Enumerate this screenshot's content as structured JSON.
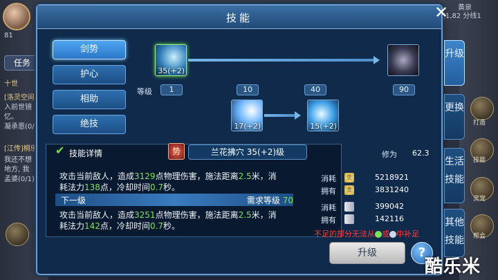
{
  "dialog": {
    "title": "技能",
    "close": "✕"
  },
  "hud": {
    "level": "81",
    "player_name": "龙游寒男人",
    "top_right_map": "黄泉",
    "top_right_coords": "(1,82 分线1",
    "task_tab": "任务",
    "left_lines": [
      "十世",
      "[洛灵空间]",
      "入前世镜",
      "忆。",
      "凝承恩(0/",
      "[江传]桐乐",
      "我还不想",
      "地方, 我",
      "孟婆(0/1)"
    ],
    "right_labels": [
      "打造",
      "技能",
      "灵宠",
      "帮会"
    ]
  },
  "categories": [
    {
      "label": "剑势",
      "active": true
    },
    {
      "label": "护心",
      "active": false
    },
    {
      "label": "相助",
      "active": false
    },
    {
      "label": "绝技",
      "active": false
    }
  ],
  "tree": {
    "level_label": "等级",
    "levels": [
      "1",
      "10",
      "40",
      "90"
    ],
    "skills": [
      {
        "name": "sword-skill",
        "level": "35(+2)"
      },
      {
        "name": "locked-blade-skill",
        "level": ""
      },
      {
        "name": "slash-skill",
        "level": "17(+2)"
      },
      {
        "name": "dash-skill",
        "level": "15(+2)"
      }
    ]
  },
  "detail": {
    "header": "技能详情",
    "emblem": "势",
    "skill_name": "兰花拂穴 35(+2)级",
    "current": {
      "line1_pre": "攻击当前敌人，造成",
      "line1_dmg": "3129",
      "line1_mid": "点物理伤害，施法距离",
      "line1_dist": "2.5",
      "line1_post": "米，消",
      "line2_pre": "耗法力",
      "line2_mana": "138",
      "line2_mid": "点，冷却时间",
      "line2_cd": "0.7",
      "line2_post": "秒。"
    },
    "next_label": "下一级",
    "next_req_label": "需求等级",
    "next_req_value": "70",
    "next": {
      "line1_pre": "攻击当前敌人，造成",
      "line1_dmg": "3251",
      "line1_mid": "点物理伤害，施法距离",
      "line1_dist": "2.5",
      "line1_post": "米，消",
      "line2_pre": "耗法力",
      "line2_mana": "142",
      "line2_mid": "点，冷却时间",
      "line2_cd": "0.7",
      "line2_post": "秒。"
    }
  },
  "cost": {
    "xiuwei_label": "修为",
    "xiuwei_value": "62.3",
    "consume_label": "消耗",
    "own_label": "拥有",
    "gold_consume": "5218921",
    "gold_own": "3831240",
    "scroll_consume": "399042",
    "scroll_own": "142116",
    "warning_pre": "不足的部分无法从",
    "warning_or": "或",
    "warning_post": "中补足"
  },
  "upgrade_button": "升级",
  "help_button": "?",
  "right_tabs": [
    {
      "label": "升级",
      "active": true
    },
    {
      "label": "更换",
      "active": false
    },
    {
      "label": "生活技能",
      "active": false
    },
    {
      "label": "其他技能",
      "active": false
    }
  ],
  "watermark": "酷乐米",
  "colors": {
    "highlight": "#7fe05a",
    "warning": "#ff3b3b",
    "accent": "#3d86cc"
  }
}
